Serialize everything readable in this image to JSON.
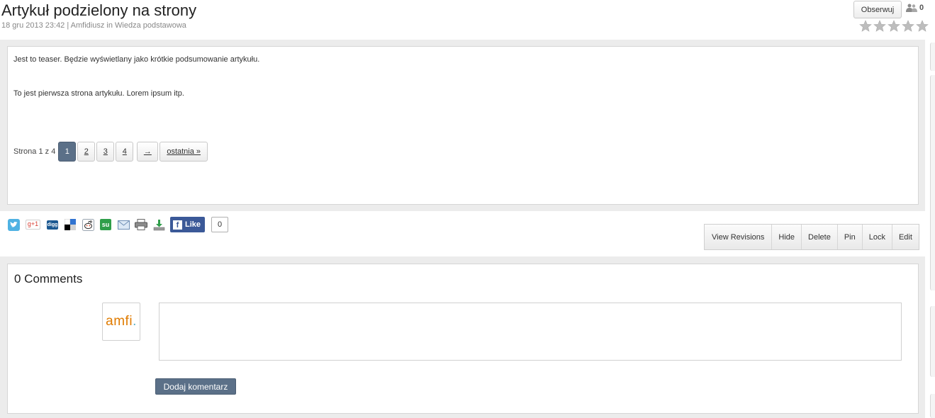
{
  "article": {
    "title": "Artykuł podzielony na strony",
    "meta": "18 gru 2013 23:42 | Amfidiusz in Wiedza podstawowa",
    "teaser": "Jest to teaser. Będzie wyświetlany jako krótkie podsumowanie artykułu.",
    "body": "To jest pierwsza strona artykułu. Lorem ipsum itp."
  },
  "follow": {
    "button_label": "Obserwuj",
    "followers_count": "0"
  },
  "rating": {
    "max_stars": 5,
    "value": 0
  },
  "pagination": {
    "label": "Strona 1 z 4",
    "pages": [
      "1",
      "2",
      "3",
      "4"
    ],
    "current": "1",
    "next_label": "→",
    "last_label": "ostatnia »"
  },
  "share": {
    "icons": [
      "twitter-icon",
      "google-plus-icon",
      "digg-icon",
      "delicious-icon",
      "reddit-icon",
      "stumbleupon-icon",
      "email-icon",
      "print-icon",
      "download-icon"
    ],
    "gplus_label": "g+1",
    "digg_label": "digg",
    "stumble_label": "su",
    "fb_like_label": "Like",
    "fb_like_count": "0"
  },
  "actions": [
    "View Revisions",
    "Hide",
    "Delete",
    "Pin",
    "Lock",
    "Edit"
  ],
  "comments": {
    "title": "0 Comments",
    "avatar_text": "amfi",
    "avatar_dot": ".",
    "input_value": "",
    "submit_label": "Dodaj komentarz"
  },
  "colors": {
    "accent_button": "#5b7088",
    "facebook": "#3b5998",
    "avatar_orange": "#e07b00",
    "star_gray": "#bdbdbd"
  }
}
